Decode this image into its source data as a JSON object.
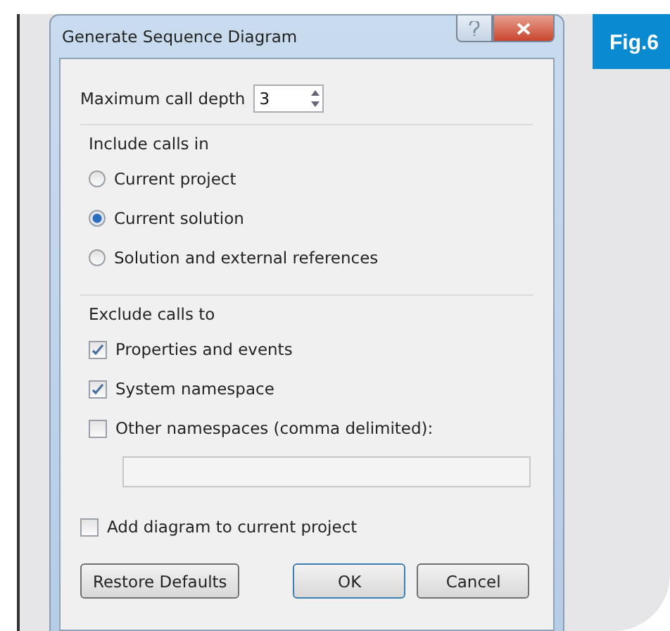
{
  "window": {
    "title": "Generate Sequence Diagram"
  },
  "figure_label": "Fig.6",
  "max_call_depth": {
    "label": "Maximum call depth",
    "value": "3"
  },
  "include_calls": {
    "label": "Include calls in",
    "options": [
      {
        "label": "Current project",
        "selected": false
      },
      {
        "label": "Current solution",
        "selected": true
      },
      {
        "label": "Solution and external references",
        "selected": false
      }
    ]
  },
  "exclude_calls": {
    "label": "Exclude calls to",
    "items": [
      {
        "label": "Properties and events",
        "checked": true
      },
      {
        "label": "System namespace",
        "checked": true
      },
      {
        "label": "Other namespaces (comma delimited):",
        "checked": false
      }
    ]
  },
  "add_to_project": {
    "label": "Add diagram to current project",
    "checked": false
  },
  "buttons": [
    {
      "label": "Restore Defaults",
      "default": false
    },
    {
      "label": "OK",
      "default": true
    },
    {
      "label": "Cancel",
      "default": false
    }
  ]
}
